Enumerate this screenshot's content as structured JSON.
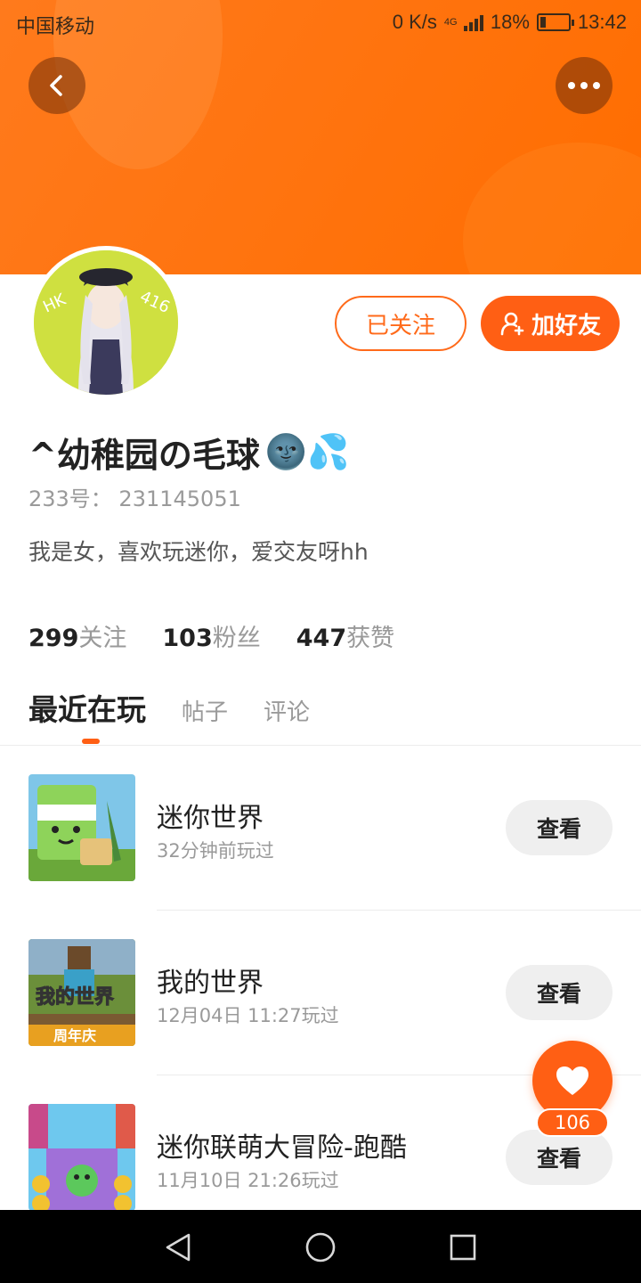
{
  "status_bar": {
    "carrier": "中国移动",
    "net_speed": "0 K/s",
    "network": "4G",
    "battery": "18%",
    "time": "13:42"
  },
  "header": {
    "back_icon": "chevron-left-icon",
    "more_icon": "more-dots-icon"
  },
  "profile": {
    "avatar_text": "HK 416",
    "follow_label": "已关注",
    "add_friend_label": "加好友",
    "username": "^幼稚园の毛球",
    "username_emojis": "🌚💦",
    "id_text": "233号：  231145051",
    "bio": "我是女，喜欢玩迷你，爱交友呀hh",
    "stats": [
      {
        "value": "299",
        "label": "关注"
      },
      {
        "value": "103",
        "label": "粉丝"
      },
      {
        "value": "447",
        "label": "获赞"
      }
    ]
  },
  "tabs": [
    {
      "label": "最近在玩",
      "active": true
    },
    {
      "label": "帖子",
      "active": false
    },
    {
      "label": "评论",
      "active": false
    }
  ],
  "games": [
    {
      "name": "迷你世界",
      "time": "32分钟前玩过",
      "button": "查看"
    },
    {
      "name": "我的世界",
      "time": "12月04日 11:27玩过",
      "button": "查看",
      "thumb_text": "我的世界",
      "thumb_badge": "周年庆"
    },
    {
      "name": "迷你联萌大冒险-跑酷",
      "time": "11月10日 21:26玩过",
      "button": "查看"
    }
  ],
  "like": {
    "count": "106",
    "icon": "heart-icon"
  },
  "colors": {
    "accent": "#ff5f14",
    "banner": "#ff7410"
  }
}
